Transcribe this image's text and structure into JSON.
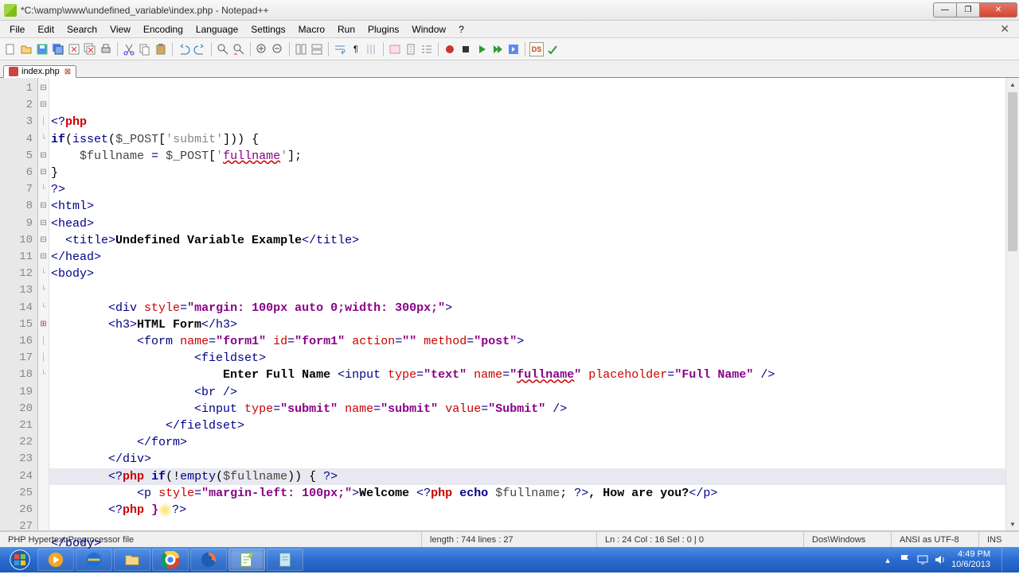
{
  "window": {
    "title": "*C:\\wamp\\www\\undefined_variable\\index.php - Notepad++"
  },
  "menu": {
    "items": [
      "File",
      "Edit",
      "Search",
      "View",
      "Encoding",
      "Language",
      "Settings",
      "Macro",
      "Run",
      "Plugins",
      "Window",
      "?"
    ]
  },
  "tab": {
    "name": "index.php"
  },
  "code": {
    "lines": [
      1,
      2,
      3,
      4,
      5,
      6,
      7,
      8,
      9,
      10,
      11,
      12,
      13,
      14,
      15,
      16,
      17,
      18,
      19,
      20,
      21,
      22,
      23,
      24,
      25,
      26,
      27
    ]
  },
  "statusbar": {
    "filetype": "PHP Hypertext Preprocessor file",
    "length": "length : 744    lines : 27",
    "pos": "Ln : 24    Col : 16    Sel : 0 | 0",
    "eol": "Dos\\Windows",
    "enc": "ANSI as UTF-8",
    "ins": "INS"
  },
  "clock": {
    "time": "4:49 PM",
    "date": "10/6/2013"
  }
}
